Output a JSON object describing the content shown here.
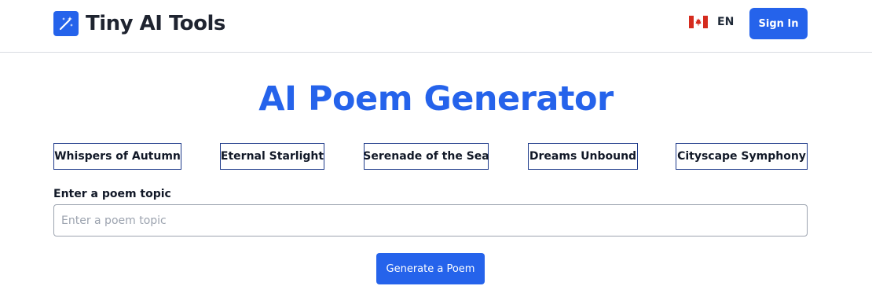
{
  "header": {
    "brand": "Tiny AI Tools",
    "brand_icon": "magic-wand-icon",
    "language": {
      "flag": "canada-flag-icon",
      "code": "EN"
    },
    "signin_label": "Sign In"
  },
  "main": {
    "title": "AI Poem Generator",
    "suggestions": [
      "Whispers of Autumn",
      "Eternal Starlight",
      "Serenade of the Sea",
      "Dreams Unbound",
      "Cityscape Symphony"
    ],
    "topic_field": {
      "label": "Enter a poem topic",
      "placeholder": "Enter a poem topic",
      "value": ""
    },
    "generate_label": "Generate a Poem"
  },
  "colors": {
    "accent": "#2563eb",
    "chip_border": "#1e3a8a",
    "flag_red": "#d52b1e"
  }
}
